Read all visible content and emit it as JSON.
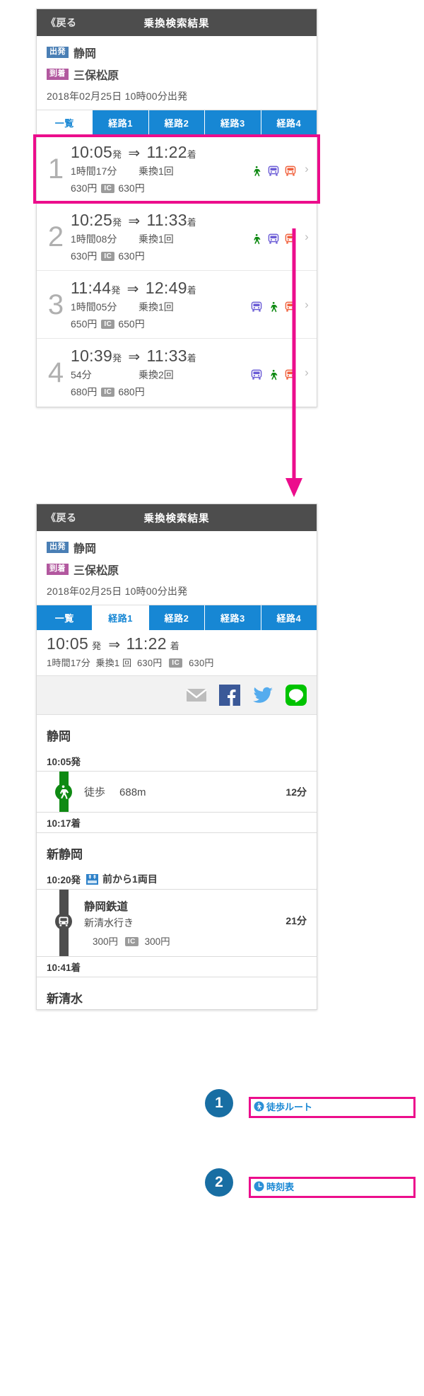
{
  "titlebar": {
    "back_label": "《戻る",
    "title": "乗換検索結果"
  },
  "od": {
    "departure_tag": "出発",
    "departure_name": "静岡",
    "arrival_tag": "到着",
    "arrival_name": "三保松原",
    "datetime": "2018年02月25日 10時00分出発"
  },
  "tabs": {
    "list": "一覧",
    "route1": "経路1",
    "route2": "経路2",
    "route3": "経路3",
    "route4": "経路4"
  },
  "results": [
    {
      "rank": "1",
      "depart": "10:05",
      "depart_suffix": "発",
      "arrow": "⇒",
      "arrive": "11:22",
      "arrive_suffix": "着",
      "duration": "1時間17分",
      "transfers": "乗換1回",
      "fare": "630円",
      "ic_label": "IC",
      "ic_fare": "630円",
      "modes": [
        "walk",
        "train",
        "bus"
      ],
      "chevron": "›"
    },
    {
      "rank": "2",
      "depart": "10:25",
      "depart_suffix": "発",
      "arrow": "⇒",
      "arrive": "11:33",
      "arrive_suffix": "着",
      "duration": "1時間08分",
      "transfers": "乗換1回",
      "fare": "630円",
      "ic_label": "IC",
      "ic_fare": "630円",
      "modes": [
        "walk",
        "train",
        "bus"
      ],
      "chevron": "›"
    },
    {
      "rank": "3",
      "depart": "11:44",
      "depart_suffix": "発",
      "arrow": "⇒",
      "arrive": "12:49",
      "arrive_suffix": "着",
      "duration": "1時間05分",
      "transfers": "乗換1回",
      "fare": "650円",
      "ic_label": "IC",
      "ic_fare": "650円",
      "modes": [
        "train",
        "walk",
        "bus"
      ],
      "chevron": "›"
    },
    {
      "rank": "4",
      "depart": "10:39",
      "depart_suffix": "発",
      "arrow": "⇒",
      "arrive": "11:33",
      "arrive_suffix": "着",
      "duration": "54分",
      "transfers": "乗換2回",
      "fare": "680円",
      "ic_label": "IC",
      "ic_fare": "680円",
      "modes": [
        "train",
        "walk",
        "bus"
      ],
      "chevron": "›"
    }
  ],
  "detail": {
    "summary": {
      "depart": "10:05",
      "depart_suffix": "発",
      "arrow": "⇒",
      "arrive": "11:22",
      "arrive_suffix": "着",
      "meta_duration": "1時間17分",
      "meta_transfers": "乗換1 回",
      "meta_fare": "630円",
      "ic_label": "IC",
      "ic_fare": "630円"
    },
    "share": [
      "mail-icon",
      "facebook-icon",
      "twitter-icon",
      "line-icon"
    ],
    "timeline": {
      "station1": "静岡",
      "time1": "10:05発",
      "walk_label": "徒歩",
      "walk_distance": "688m",
      "walk_duration": "12分",
      "walk_route_pill": "徒歩ルート",
      "time2": "10:17着",
      "station2": "新静岡",
      "timetable_pill": "時刻表",
      "time3": "10:20発",
      "car_position": "前から1両目",
      "line_name": "静岡鉄道",
      "destination": "新清水行き",
      "train_duration": "21分",
      "train_fare": "300円",
      "train_ic_label": "IC",
      "train_ic_fare": "300円",
      "time4": "10:41着",
      "station3": "新清水"
    },
    "step_badges": [
      "1",
      "2"
    ]
  },
  "colors": {
    "accent_blue": "#1787d4",
    "highlight_pink": "#ec0d8c",
    "walk_green": "#0f8a13",
    "train_purple": "#6b5cd6",
    "bus_orange": "#f0603c",
    "titlebar_gray": "#4d4d4d",
    "badge_blue": "#186ea3"
  }
}
